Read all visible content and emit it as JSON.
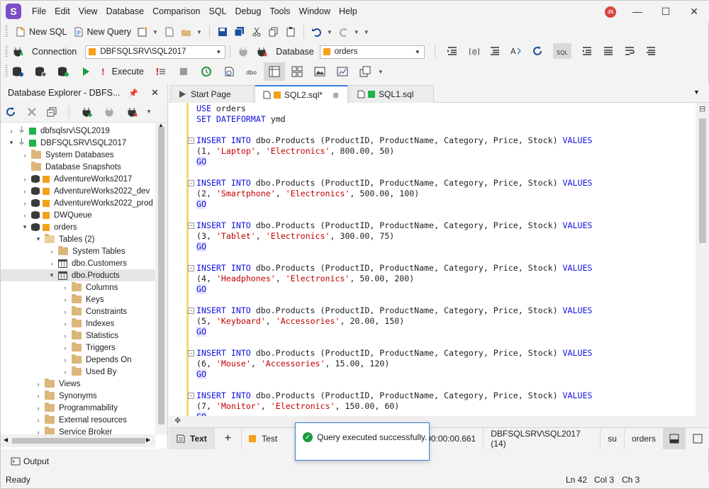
{
  "app": {
    "logo": "S",
    "user_initials": "JS"
  },
  "menu": [
    "File",
    "Edit",
    "View",
    "Database",
    "Comparison",
    "SQL",
    "Debug",
    "Tools",
    "Window",
    "Help"
  ],
  "toolbar1": {
    "new_sql": "New SQL",
    "new_query": "New Query"
  },
  "toolbar2": {
    "connection_label": "Connection",
    "connection_value": "DBFSQLSRV\\SQL2017",
    "database_label": "Database",
    "database_value": "orders"
  },
  "toolbar3": {
    "execute": "Execute"
  },
  "explorer": {
    "title": "Database Explorer - DBFS...",
    "nodes": [
      {
        "label": "dbfsqlsrv\\SQL2019",
        "level": 0,
        "arrow": "›",
        "icon": "server"
      },
      {
        "label": "DBFSQLSRV\\SQL2017",
        "level": 0,
        "arrow": "⌄",
        "icon": "server"
      },
      {
        "label": "System Databases",
        "level": 1,
        "arrow": "›",
        "icon": "folder"
      },
      {
        "label": "Database Snapshots",
        "level": 1,
        "arrow": "",
        "icon": "folder"
      },
      {
        "label": "AdventureWorks2017",
        "level": 1,
        "arrow": "›",
        "icon": "db"
      },
      {
        "label": "AdventureWorks2022_dev",
        "level": 1,
        "arrow": "›",
        "icon": "db"
      },
      {
        "label": "AdventureWorks2022_prod",
        "level": 1,
        "arrow": "›",
        "icon": "db"
      },
      {
        "label": "DWQueue",
        "level": 1,
        "arrow": "›",
        "icon": "db"
      },
      {
        "label": "orders",
        "level": 1,
        "arrow": "⌄",
        "icon": "db"
      },
      {
        "label": "Tables (2)",
        "level": 2,
        "arrow": "⌄",
        "icon": "folder-open"
      },
      {
        "label": "System Tables",
        "level": 3,
        "arrow": "›",
        "icon": "folder"
      },
      {
        "label": "dbo.Customers",
        "level": 3,
        "arrow": "›",
        "icon": "table"
      },
      {
        "label": "dbo.Products",
        "level": 3,
        "arrow": "⌄",
        "icon": "table",
        "selected": true
      },
      {
        "label": "Columns",
        "level": 4,
        "arrow": "›",
        "icon": "folder"
      },
      {
        "label": "Keys",
        "level": 4,
        "arrow": "›",
        "icon": "folder"
      },
      {
        "label": "Constraints",
        "level": 4,
        "arrow": "›",
        "icon": "folder"
      },
      {
        "label": "Indexes",
        "level": 4,
        "arrow": "›",
        "icon": "folder"
      },
      {
        "label": "Statistics",
        "level": 4,
        "arrow": "›",
        "icon": "folder"
      },
      {
        "label": "Triggers",
        "level": 4,
        "arrow": "›",
        "icon": "folder"
      },
      {
        "label": "Depends On",
        "level": 4,
        "arrow": "›",
        "icon": "folder"
      },
      {
        "label": "Used By",
        "level": 4,
        "arrow": "›",
        "icon": "folder"
      },
      {
        "label": "Views",
        "level": 2,
        "arrow": "›",
        "icon": "folder"
      },
      {
        "label": "Synonyms",
        "level": 2,
        "arrow": "›",
        "icon": "folder"
      },
      {
        "label": "Programmability",
        "level": 2,
        "arrow": "›",
        "icon": "folder"
      },
      {
        "label": "External resources",
        "level": 2,
        "arrow": "›",
        "icon": "folder"
      },
      {
        "label": "Service Broker",
        "level": 2,
        "arrow": "›",
        "icon": "folder"
      }
    ]
  },
  "tabs": [
    {
      "label": "Start Page"
    },
    {
      "label": "SQL2.sql*"
    },
    {
      "label": "SQL1.sql"
    }
  ],
  "editor": {
    "use_line": [
      "USE",
      " orders"
    ],
    "set_line": [
      "SET DATEFORMAT",
      " ymd"
    ],
    "insert_prefix": "INSERT INTO",
    "insert_body": " dbo.Products (ProductID, ProductName, Category, Price, Stock) ",
    "values_kw": "VALUES",
    "go": "GO",
    "rows": [
      {
        "id": "1",
        "name": "'Laptop'",
        "cat": "'Electronics'",
        "price": "800.00",
        "stock": "50"
      },
      {
        "id": "2",
        "name": "'Smartphone'",
        "cat": "'Electronics'",
        "price": "500.00",
        "stock": "100"
      },
      {
        "id": "3",
        "name": "'Tablet'",
        "cat": "'Electronics'",
        "price": "300.00",
        "stock": "75"
      },
      {
        "id": "4",
        "name": "'Headphones'",
        "cat": "'Electronics'",
        "price": "50.00",
        "stock": "200"
      },
      {
        "id": "5",
        "name": "'Keyboard'",
        "cat": "'Accessories'",
        "price": "20.00",
        "stock": "150"
      },
      {
        "id": "6",
        "name": "'Mouse'",
        "cat": "'Accessories'",
        "price": "15.00",
        "stock": "120"
      },
      {
        "id": "7",
        "name": "'Monitor'",
        "cat": "'Electronics'",
        "price": "150.00",
        "stock": "60"
      }
    ]
  },
  "results": {
    "text_tab": "Text",
    "add": "+",
    "test": "Test",
    "toast": "Query executed successfully.",
    "elapsed": "00:00:00.661",
    "server": "DBFSQLSRV\\SQL2017 (14)",
    "user": "su",
    "database": "orders"
  },
  "output": "Output",
  "status": {
    "state": "Ready",
    "ln": "Ln 42",
    "col": "Col 3",
    "ch": "Ch 3"
  }
}
